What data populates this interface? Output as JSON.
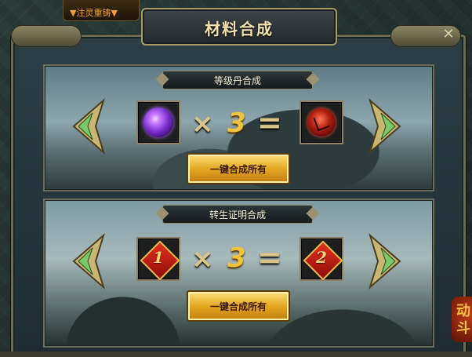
{
  "top_tab": {
    "label": "▼注灵重铸▼"
  },
  "window": {
    "title": "材料合成",
    "close_glyph": "✕"
  },
  "sections": [
    {
      "title": "等级丹合成",
      "multiplier_symbol": "×",
      "count": "3",
      "equals_symbol": "=",
      "button_label": "一键合成所有"
    },
    {
      "title": "转生证明合成",
      "multiplier_symbol": "×",
      "count": "3",
      "equals_symbol": "=",
      "input_number": "1",
      "output_number": "2",
      "button_label": "一键合成所有"
    }
  ],
  "side_badge": {
    "text": "动\n斗"
  },
  "colors": {
    "gold": "#f0c43a",
    "frame": "#6d6a52",
    "title": "#f3e2b0"
  }
}
